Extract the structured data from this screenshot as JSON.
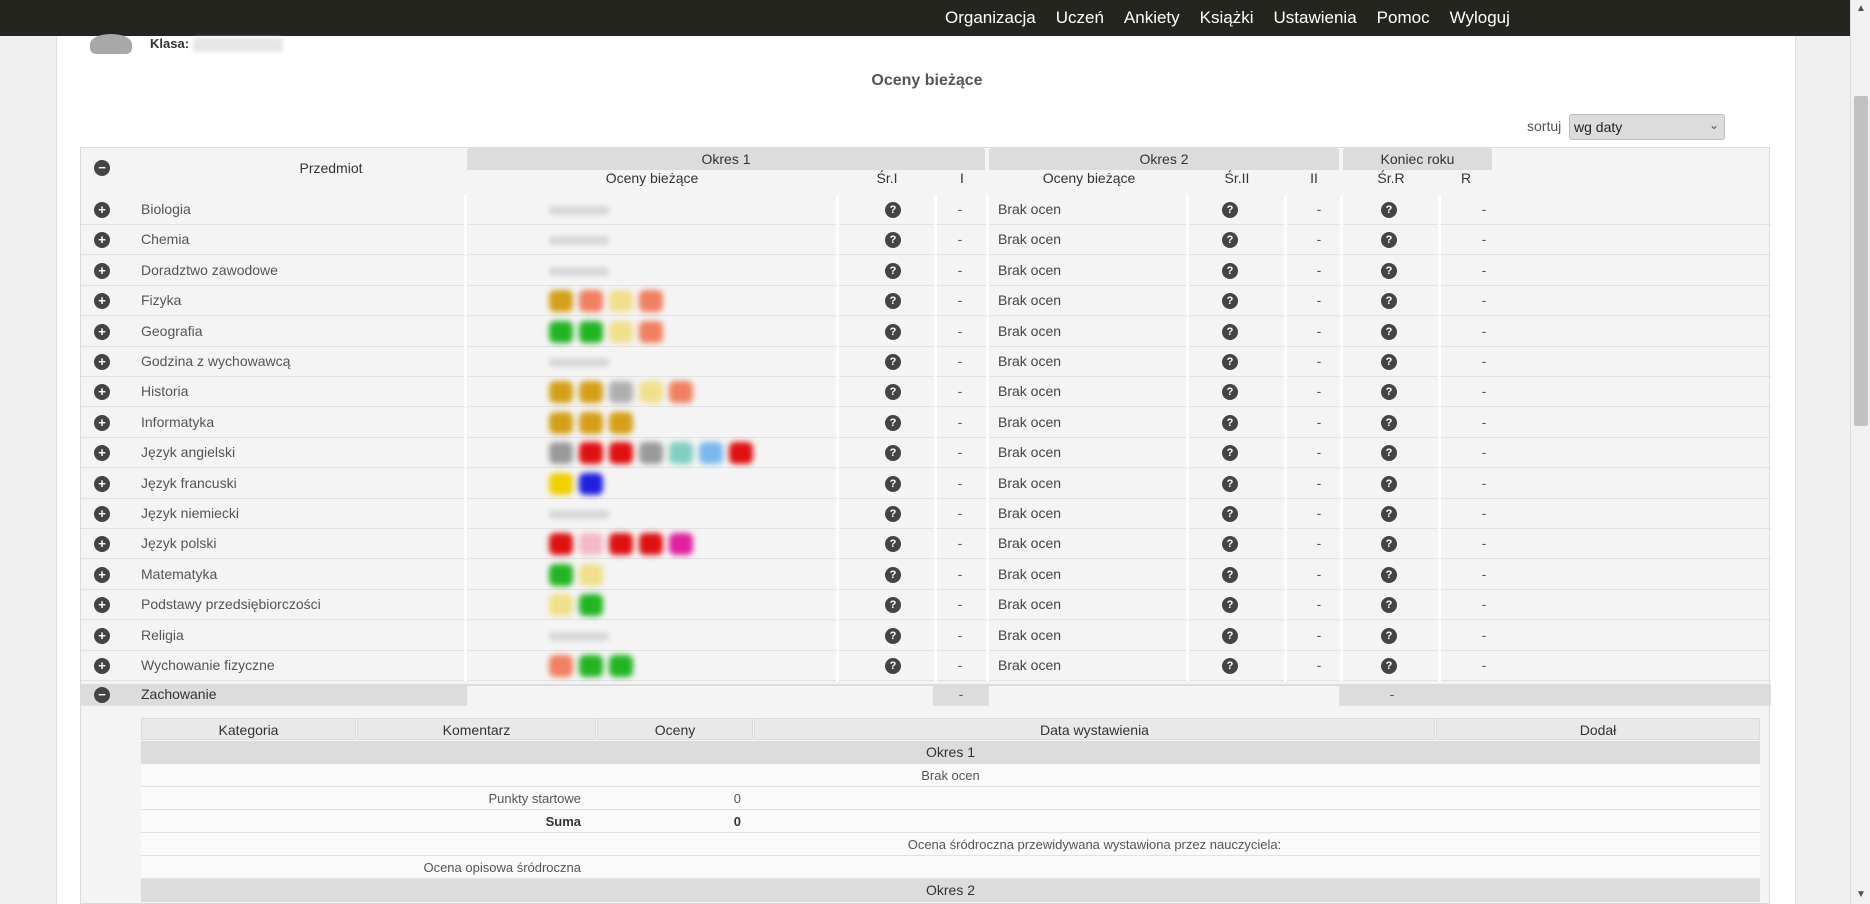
{
  "nav": [
    "Organizacja",
    "Uczeń",
    "Ankiety",
    "Książki",
    "Ustawienia",
    "Pomoc",
    "Wyloguj"
  ],
  "klasa_label": "Klasa:",
  "page_title": "Oceny bieżące",
  "sort": {
    "label": "sortuj",
    "value": "wg daty"
  },
  "table": {
    "przedmiot_header": "Przedmiot",
    "okres1": "Okres 1",
    "okres2": "Okres 2",
    "koniec_roku": "Koniec roku",
    "oceny_biezace": "Oceny bieżące",
    "sr1": "Śr.I",
    "i": "I",
    "sr2": "Śr.II",
    "ii": "II",
    "srr": "Śr.R",
    "r": "R",
    "brak_ocen": "Brak ocen",
    "dash": "-",
    "qmark": "?",
    "subjects": [
      "Biologia",
      "Chemia",
      "Doradztwo zawodowe",
      "Fizyka",
      "Geografia",
      "Godzina z wychowawcą",
      "Historia",
      "Informatyka",
      "Język angielski",
      "Język francuski",
      "Język niemiecki",
      "Język polski",
      "Matematyka",
      "Podstawy przedsiębiorczości",
      "Religia",
      "Wychowanie fizyczne"
    ],
    "grade_colors": [
      [],
      [],
      [],
      [
        "#d4a017",
        "#f08060",
        "#f0e08a",
        "#f08060"
      ],
      [
        "#22b522",
        "#22b522",
        "#f0e08a",
        "#f08060"
      ],
      [],
      [
        "#d4a017",
        "#d4a017",
        "#b0b0b0",
        "#f0e08a",
        "#f08060"
      ],
      [
        "#d4a017",
        "#d4a017",
        "#d4a017"
      ],
      [
        "#9a9a9a",
        "#e01010",
        "#e01010",
        "#9a9a9a",
        "#80d0c0",
        "#7ab8f0",
        "#e01010"
      ],
      [
        "#f0d000",
        "#2020e0"
      ],
      [],
      [
        "#e01010",
        "#f4b8c8",
        "#e01010",
        "#e01010",
        "#e020a0"
      ],
      [
        "#22b522",
        "#f0e08a"
      ],
      [
        "#f0e08a",
        "#22b522"
      ],
      [],
      [
        "#f08060",
        "#22b522",
        "#22b522"
      ]
    ],
    "zachowanie": "Zachowanie"
  },
  "behaviour": {
    "headers": [
      "Kategoria",
      "Komentarz",
      "Oceny",
      "Data wystawienia",
      "Dodał"
    ],
    "okres1": "Okres 1",
    "brak_ocen": "Brak ocen",
    "punkty_startowe": "Punkty startowe",
    "punkty_value": "0",
    "suma": "Suma",
    "suma_value": "0",
    "przewidywana": "Ocena śródroczna przewidywana wystawiona przez nauczyciela:",
    "opisowa": "Ocena opisowa śródroczna",
    "okres2": "Okres 2"
  }
}
